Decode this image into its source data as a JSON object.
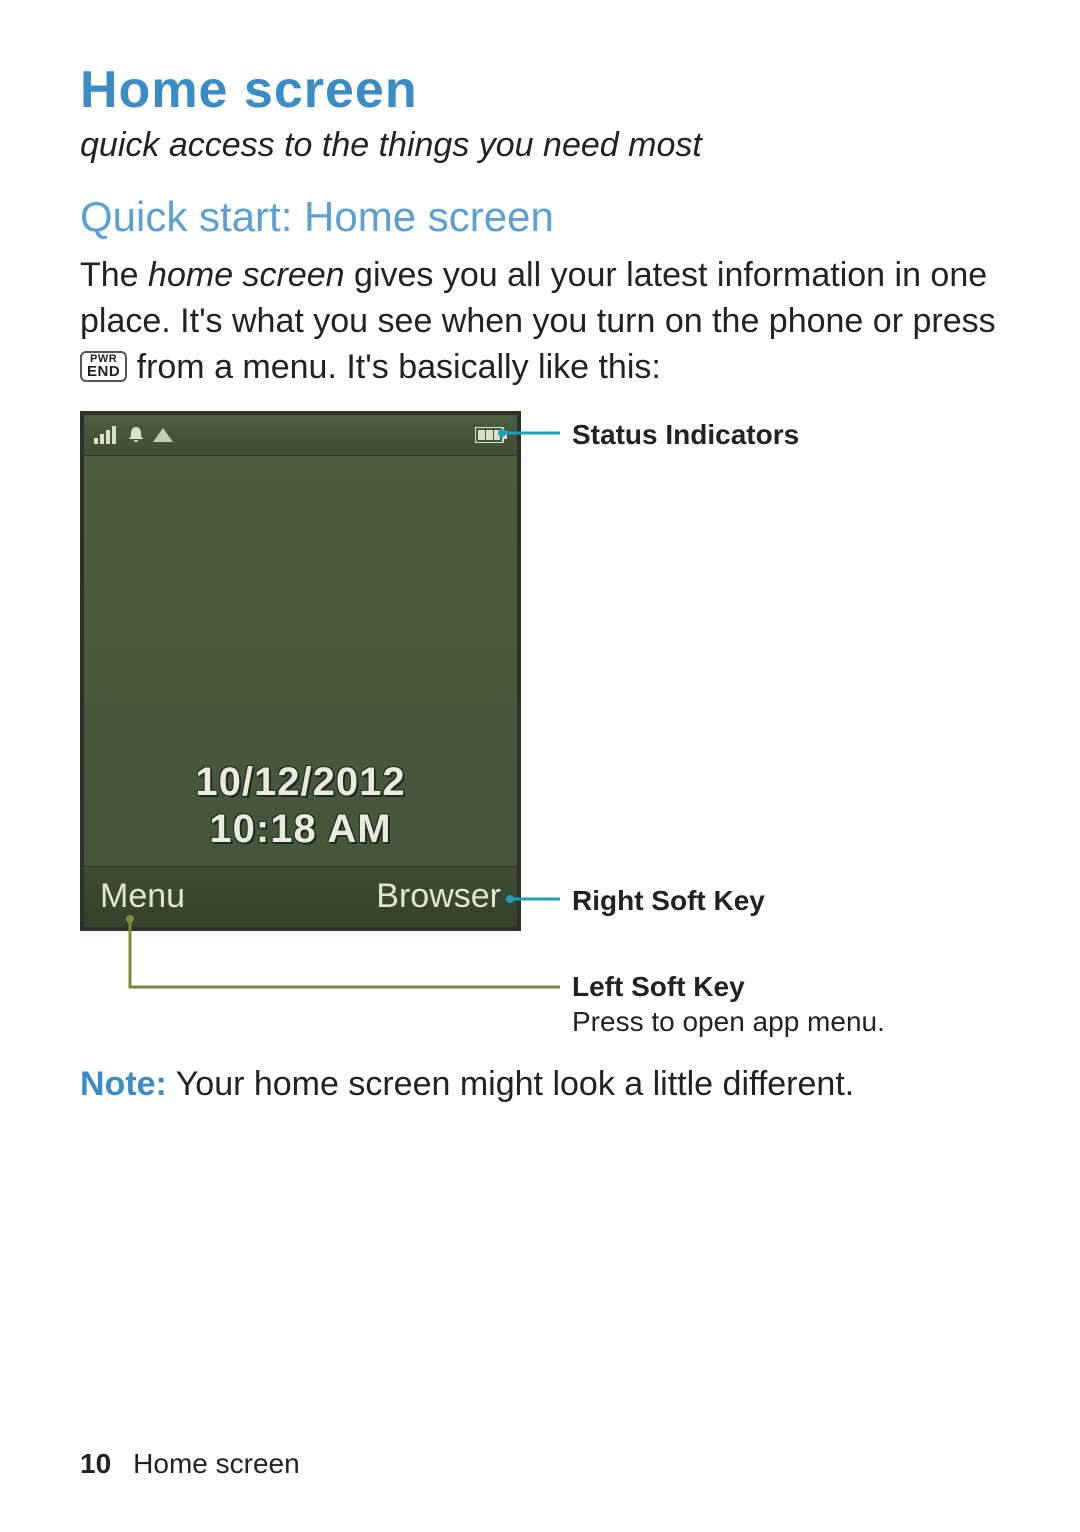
{
  "heading": {
    "title": "Home screen",
    "subtitle": "quick access to the things you need most",
    "section": "Quick start: Home screen"
  },
  "body": {
    "intro_part1": "The ",
    "intro_italic": "home screen",
    "intro_part2": " gives you all your latest information in one place. It's what you see when you turn on the phone or press ",
    "intro_part3": " from a menu. It's basically like this:",
    "key_top": "PWR",
    "key_bottom": "END"
  },
  "phone": {
    "date": "10/12/2012",
    "time": "10:18 AM",
    "softkey_left": "Menu",
    "softkey_right": "Browser"
  },
  "callouts": {
    "status": "Status Indicators",
    "right_soft": "Right Soft Key",
    "left_soft_title": "Left Soft Key",
    "left_soft_desc": "Press to open app menu."
  },
  "note": {
    "label": "Note:",
    "text": " Your home screen might look a little different."
  },
  "footer": {
    "page_number": "10",
    "section_name": "Home screen"
  },
  "colors": {
    "teal_line": "#1aa0b8",
    "olive_line": "#7a8c38"
  }
}
